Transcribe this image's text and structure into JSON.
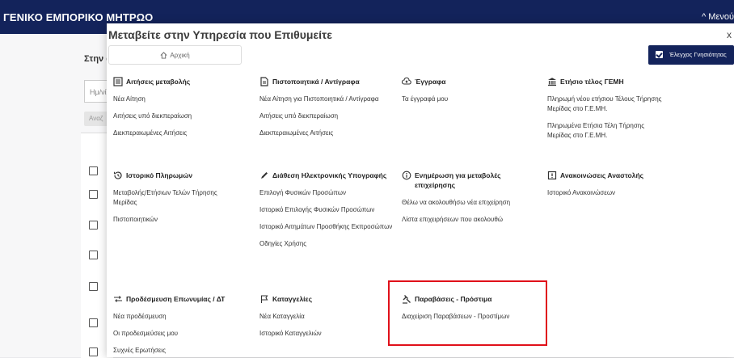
{
  "header": {
    "brand": "ΓΕΝΙΚΟ ΕΜΠΟΡΙΚΟ ΜΗΤΡΩΟ",
    "menu_label": "^ Μενού"
  },
  "background": {
    "label": "Στην α",
    "input_placeholder": "Ημ/νί",
    "button_label": "Αναζ"
  },
  "modal": {
    "title": "Μεταβείτε στην Υπηρεσία που Επιθυμείτε",
    "close": "x",
    "home_tab": "Αρχική",
    "verify_button": "Έλεγχος Γνησιότητας"
  },
  "sections": [
    {
      "icon": "list-icon",
      "title": "Αιτήσεις μεταβολής",
      "items": [
        "Νέα Αίτηση",
        "Αιτήσεις υπό διεκπεραίωση",
        "Διεκπεραιωμένες Αιτήσεις"
      ]
    },
    {
      "icon": "document-icon",
      "title": "Πιστοποιητικά / Αντίγραφα",
      "items": [
        "Νέα Αίτηση για Πιστοποιητικά / Αντίγραφα",
        "Αιτήσεις υπό διεκπεραίωση",
        "Διεκπεραιωμένες Αιτήσεις"
      ]
    },
    {
      "icon": "cloud-upload-icon",
      "title": "Έγγραφα",
      "items": [
        "Τα έγγραφά μου"
      ]
    },
    {
      "icon": "bank-icon",
      "title": "Ετήσιο τέλος ΓΕΜΗ",
      "items": [
        "Πληρωμή νέου ετήσιου Τέλους Τήρησης Μερίδας στο Γ.Ε.ΜΗ.",
        "Πληρωμένα Ετήσια Τέλη Τήρησης Μερίδας στο Γ.Ε.ΜΗ."
      ]
    },
    {
      "icon": "history-icon",
      "title": "Ιστορικό Πληρωμών",
      "items": [
        "Μεταβολής/Ετήσιων Τελών Τήρησης Μερίδας",
        "Πιστοποιητικών"
      ]
    },
    {
      "icon": "pen-icon",
      "title": "Διάθεση Ηλεκτρονικής Υπογραφής",
      "items": [
        "Επιλογή Φυσικών Προσώπων",
        "Ιστορικό Επιλογής Φυσικών Προσώπων",
        "Ιστορικό Αιτημάτων Προσθήκης Εκπροσώπων",
        "Οδηγίες Χρήσης"
      ]
    },
    {
      "icon": "info-icon",
      "title": "Ενημέρωση για μεταβολές επιχείρησης",
      "items": [
        "Θέλω να ακολουθήσω νέα επιχείρηση",
        "Λίστα επιχειρήσεων που ακολουθώ"
      ]
    },
    {
      "icon": "alert-box-icon",
      "title": "Ανακοινώσεις Αναστολής",
      "items": [
        "Ιστορικό Ανακοινώσεων"
      ]
    },
    {
      "icon": "transfer-icon",
      "title": "Προδέσμευση Επωνυμίας / ΔΤ",
      "items": [
        "Νέα προδέσμευση",
        "Οι προδεσμεύσεις μου",
        "Συχνές Ερωτήσεις"
      ]
    },
    {
      "icon": "flag-icon",
      "title": "Καταγγελίες",
      "items": [
        "Νέα Καταγγελία",
        "Ιστορικό Καταγγελιών"
      ]
    },
    {
      "icon": "gavel-icon",
      "title": "Παραβάσεις - Πρόστιμα",
      "items": [
        "Διαχείριση Παραβάσεων - Προστίμων"
      ]
    }
  ],
  "colors": {
    "navy": "#13235b",
    "highlight": "#e0101a"
  }
}
